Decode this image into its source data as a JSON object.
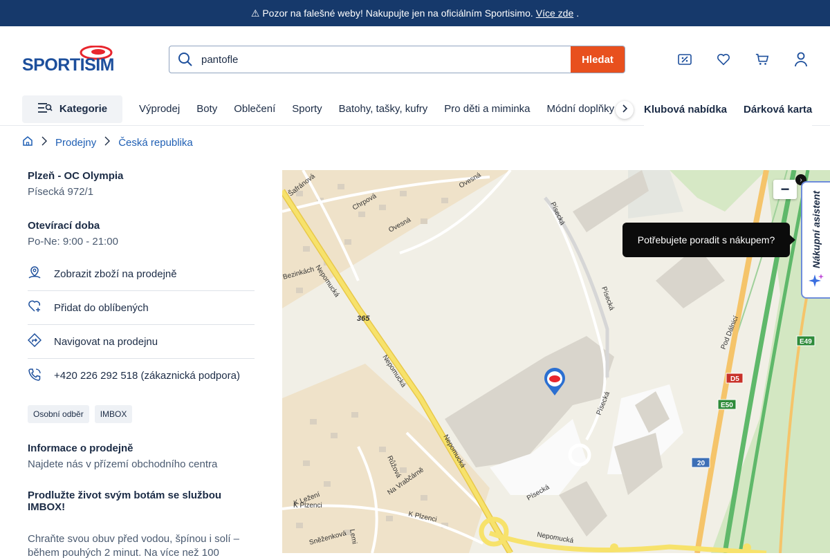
{
  "topbar": {
    "message": "⚠ Pozor na falešné weby! Nakupujte jen na oficiálním Sportisimo.",
    "link": "Více zde",
    "suffix": "."
  },
  "header": {
    "logo_text": "SPORTISIMO",
    "search_value": "pantofle",
    "search_button": "Hledat"
  },
  "nav": {
    "category_label": "Kategorie",
    "items": [
      "Výprodej",
      "Boty",
      "Oblečení",
      "Sporty",
      "Batohy, tašky, kufry",
      "Pro děti a miminka",
      "Módní doplňky"
    ],
    "bold_items": [
      "Klubová nabídka",
      "Dárková karta"
    ]
  },
  "breadcrumb": {
    "items": [
      "Prodejny",
      "Česká republika"
    ]
  },
  "store": {
    "name": "Plzeň - OC Olympia",
    "address": "Písecká 972/1",
    "hours_title": "Otevírací doba",
    "hours": "Po-Ne: 9:00 - 21:00",
    "actions": [
      "Zobrazit zboží na prodejně",
      "Přidat do oblíbených",
      "Navigovat na prodejnu",
      "+420 226 292 518 (zákaznická podpora)"
    ],
    "tags": [
      "Osobní odběr",
      "IMBOX"
    ],
    "info_title": "Informace o prodejně",
    "info_text": "Najdete nás v přízemí obchodního centra",
    "imbox_title": "Prodlužte život svým botám se službou IMBOX!",
    "imbox_text": "Chraňte svou obuv před vodou, špínou i solí – během pouhých 2 minut. Na více než 100"
  },
  "map": {
    "zoom_out": "−",
    "tooltip": "Potřebujete poradit s nákupem?",
    "assistant_label": "Nákupní asistent",
    "labels": {
      "nepomucka": "Nepomucká",
      "pisecka": "Písecká",
      "chrpova": "Chrpová",
      "ovesna": "Ovesná",
      "safranova": "Šafránová",
      "bezinkach": "Bezinkách",
      "alt": "365",
      "pod_dalnici": "Pod Dálnicí",
      "k_lezeni": "K Ležení",
      "ruzova": "Růžová",
      "na_vrabcarne": "Na Vrabčárně",
      "k_plzenci": "K Plzenci",
      "snezenkova": "Sněženková",
      "lemi": "Lemi",
      "e49": "E49",
      "d5": "D5",
      "e50": "E50",
      "r20": "20"
    }
  }
}
